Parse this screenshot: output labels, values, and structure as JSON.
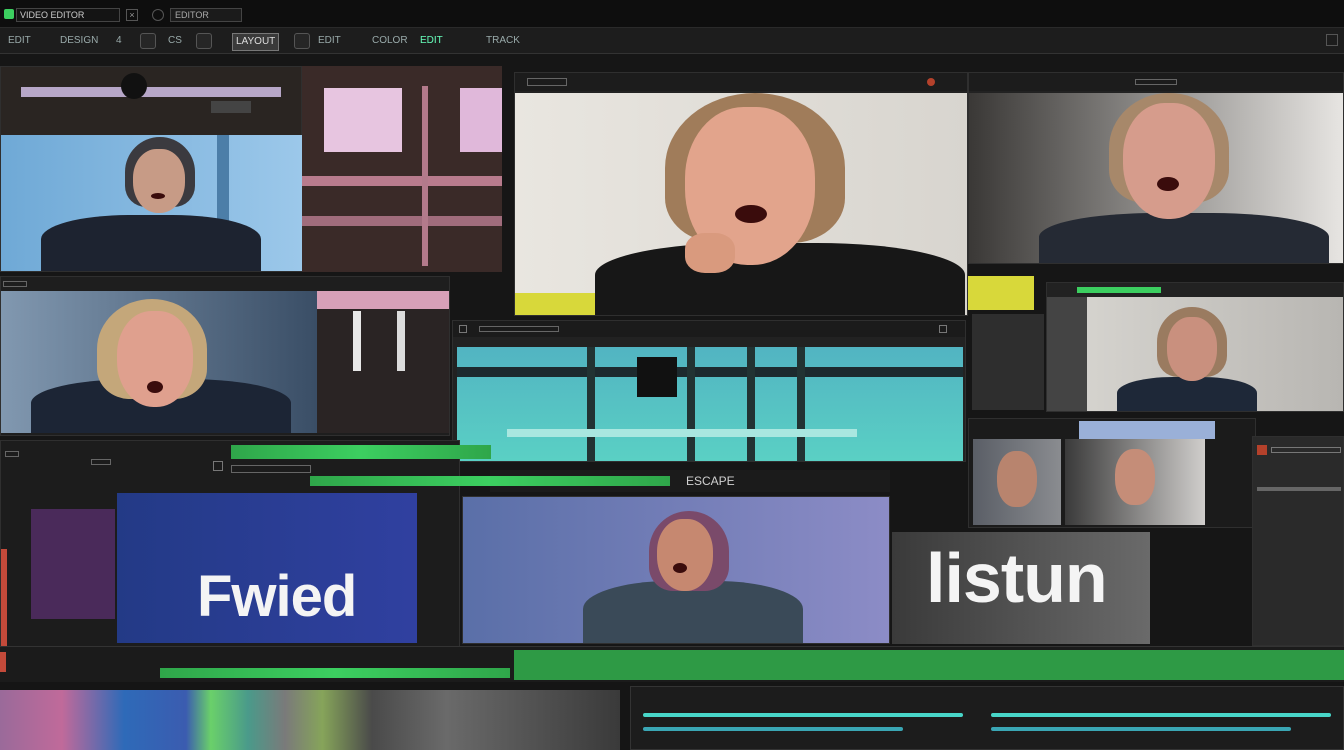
{
  "window": {
    "title": "VIDEO EDITOR",
    "tab_label": "EDITOR"
  },
  "toolbar": {
    "items": [
      "EDIT",
      "DESIGN",
      "4",
      "CS",
      "LAYOUT",
      "EDIT",
      "COLOR",
      "EDIT",
      "TRACK"
    ]
  },
  "overlays": {
    "left_title": "Fwied",
    "right_title": "listun",
    "clip_label": "ESCAPE"
  },
  "colors": {
    "accent_green": "#3ccf60",
    "timeline_green": "#2e9a45",
    "background": "#161616",
    "panel": "#222222"
  },
  "icons": [
    "app-logo-icon",
    "play-icon",
    "settings-icon",
    "cut-icon",
    "zoom-icon",
    "close-icon"
  ]
}
